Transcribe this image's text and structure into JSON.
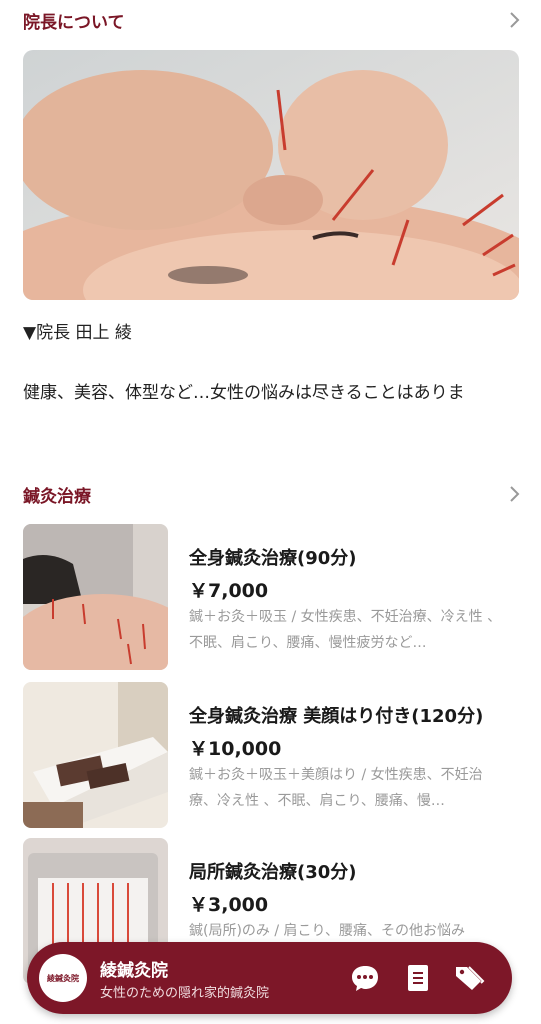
{
  "about": {
    "title": "院長について",
    "director_name": "▼院長 田上 綾",
    "intro": "健康、美容、体型など…女性の悩みは尽きることはありま"
  },
  "treatment": {
    "title": "鍼灸治療",
    "items": [
      {
        "title": "全身鍼灸治療(90分)",
        "price": "￥7,000",
        "desc": "鍼＋お灸＋吸玉 / 女性疾患、不妊治療、冷え性 、不眠、肩こり、腰痛、慢性疲労など…"
      },
      {
        "title": "全身鍼灸治療 美顔はり付き(120分)",
        "price": "￥10,000",
        "desc": "鍼＋お灸＋吸玉＋美顔はり / 女性疾患、不妊治療、冷え性 、不眠、肩こり、腰痛、慢…"
      },
      {
        "title": "局所鍼灸治療(30分)",
        "price": "￥3,000",
        "desc": "鍼(局所)のみ / 肩こり、腰痛、その他お悩み"
      }
    ]
  },
  "bottom_bar": {
    "logo_text": "綾鍼灸院",
    "name": "綾鍼灸院",
    "subtitle": "女性のための隠れ家的鍼灸院",
    "icons": [
      "chat-bubble-icon",
      "menu-document-icon",
      "tag-coupon-icon"
    ]
  },
  "colors": {
    "accent": "#7a1626",
    "bar": "#7d1728",
    "muted_text": "#9a9a9a"
  }
}
